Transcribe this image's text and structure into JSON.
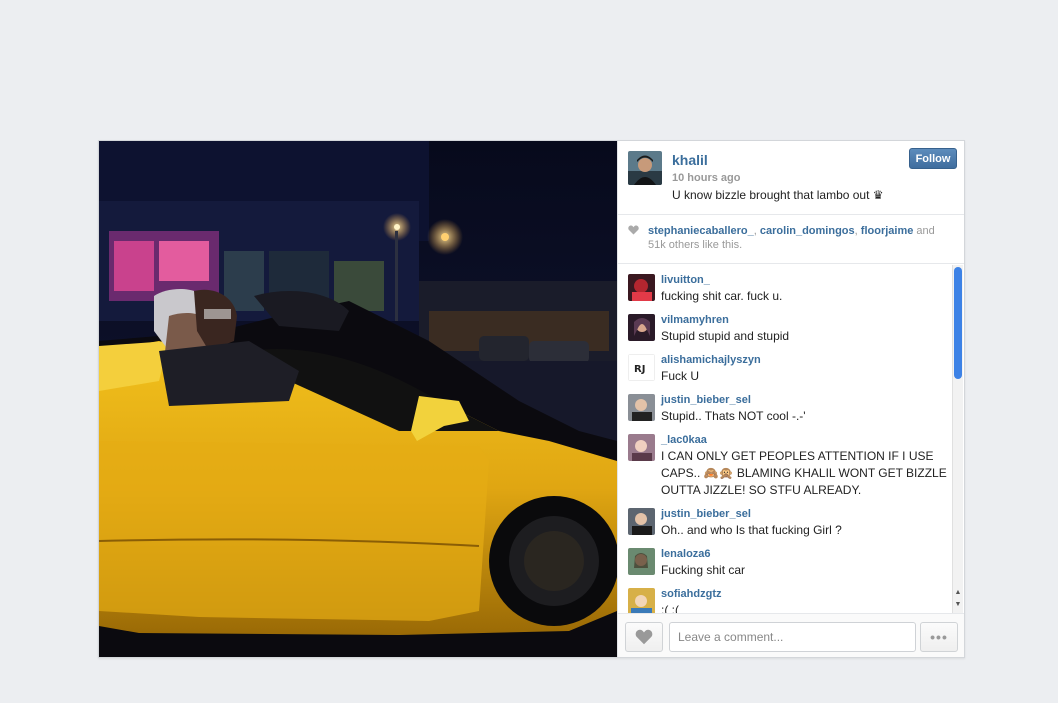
{
  "post": {
    "username": "khalil",
    "time": "10 hours ago",
    "caption": "U know bizzle brought that lambo out ♛",
    "follow_label": "Follow",
    "photo_icon": "yellow-lamborghini-night-photo"
  },
  "likes": {
    "users": [
      "stephaniecaballero_",
      "carolin_domingos",
      "floorjaime"
    ],
    "separator": ", ",
    "suffix": " and 51k others like this."
  },
  "comments": [
    {
      "user": "livuitton_",
      "text": "fucking shit car. fuck u.",
      "avatar_color": "#b3262f"
    },
    {
      "user": "vilmamyhren",
      "text": "Stupid stupid and stupid",
      "avatar_color": "#5a3a52"
    },
    {
      "user": "alishamichajlyszyn",
      "text": "Fuck U",
      "avatar_color": "#f2f2f2"
    },
    {
      "user": "justin_bieber_sel",
      "text": "Stupid.. Thats NOT cool -.-'",
      "avatar_color": "#8a8f96"
    },
    {
      "user": "_lac0kaa",
      "text": "I CAN ONLY GET PEOPLES ATTENTION IF I USE CAPS.. 🙈🙊 BLAMING KHALIL WONT GET BIZZLE OUTTA JIZZLE! SO STFU ALREADY.",
      "avatar_color": "#9a7b8d"
    },
    {
      "user": "justin_bieber_sel",
      "text": "Oh.. and who Is that fucking Girl ?",
      "avatar_color": "#5c6570"
    },
    {
      "user": "lenaloza6",
      "text": "Fucking shit car",
      "avatar_color": "#6a8a70"
    },
    {
      "user": "sofiahdzgtz",
      "text": ":( :(",
      "avatar_color": "#d7b048"
    }
  ],
  "comment_box": {
    "placeholder": "Leave a comment...",
    "more_label": "•••"
  },
  "scroll": {
    "up": "▲",
    "down": "▼"
  }
}
